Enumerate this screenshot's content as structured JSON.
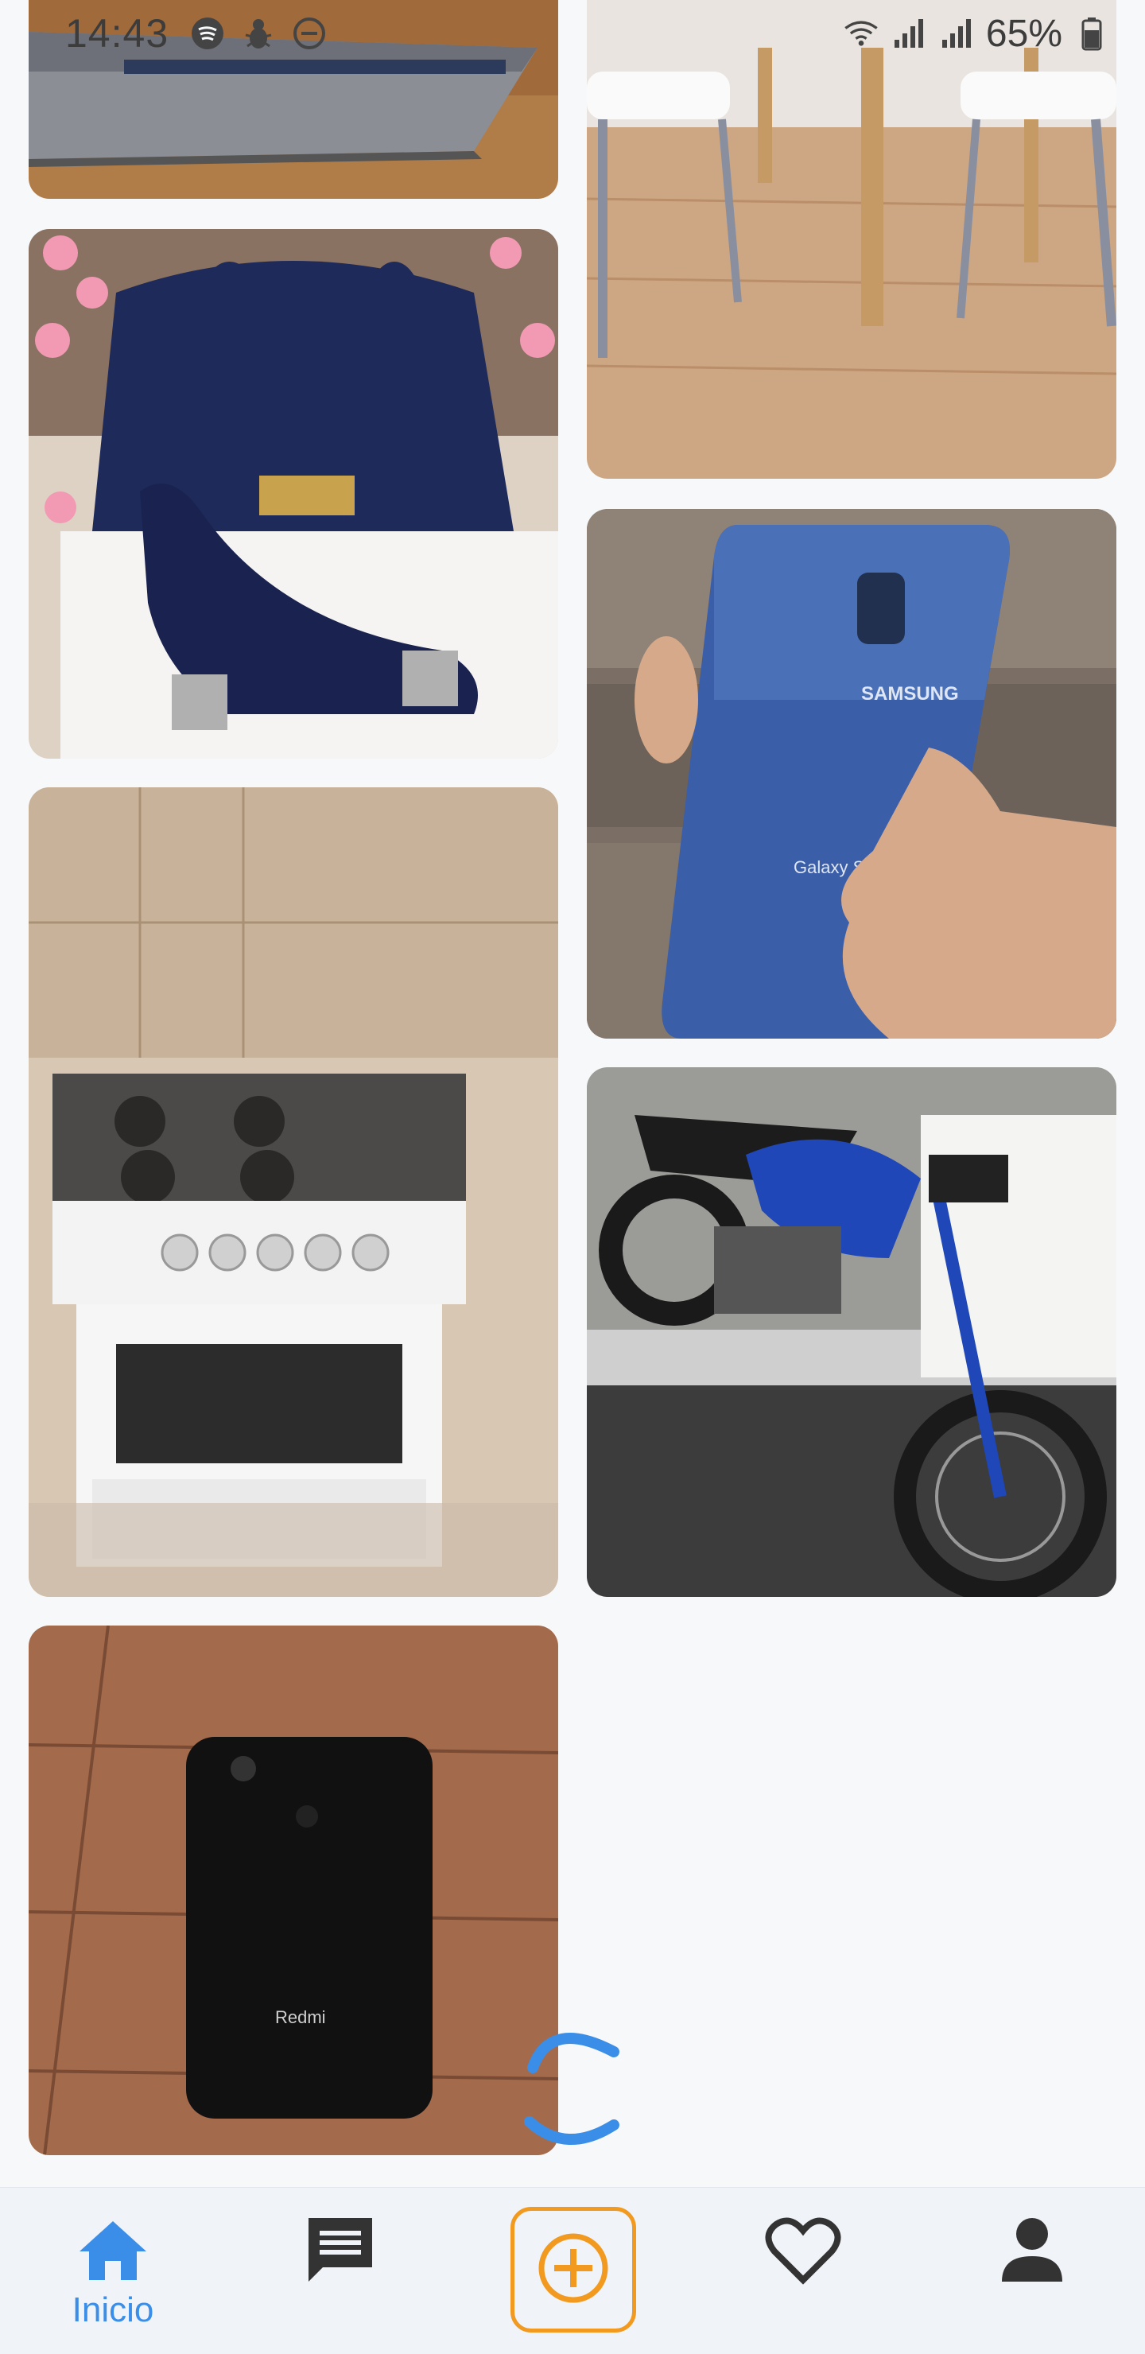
{
  "status_bar": {
    "time": "14:43",
    "battery_percent": "65%",
    "left_icons": [
      "spotify-icon",
      "bug-icon",
      "do-not-disturb-icon"
    ],
    "right_icons": [
      "wifi-icon",
      "signal-icon",
      "signal-icon",
      "battery-icon"
    ]
  },
  "listings": [
    {
      "id": "laptop",
      "subject": "laptop"
    },
    {
      "id": "chairs",
      "subject": "chairs"
    },
    {
      "id": "bag-shoes",
      "subject": "bag and shoes"
    },
    {
      "id": "phone-galaxy",
      "subject": "smartphone",
      "brand_text": "SAMSUNG",
      "model_text": "Galaxy S9"
    },
    {
      "id": "stove",
      "subject": "stove"
    },
    {
      "id": "motorcycle",
      "subject": "motorcycle"
    },
    {
      "id": "phone-redmi",
      "subject": "smartphone",
      "brand_text": "Redmi"
    }
  ],
  "bottom_nav": {
    "home_label": "Inicio",
    "items": [
      "home-icon",
      "messages-icon",
      "add-icon",
      "favorites-icon",
      "profile-icon"
    ]
  },
  "colors": {
    "accent_blue": "#3b8ee8",
    "fab_orange": "#f29a1f",
    "icon_dark": "#333333"
  }
}
